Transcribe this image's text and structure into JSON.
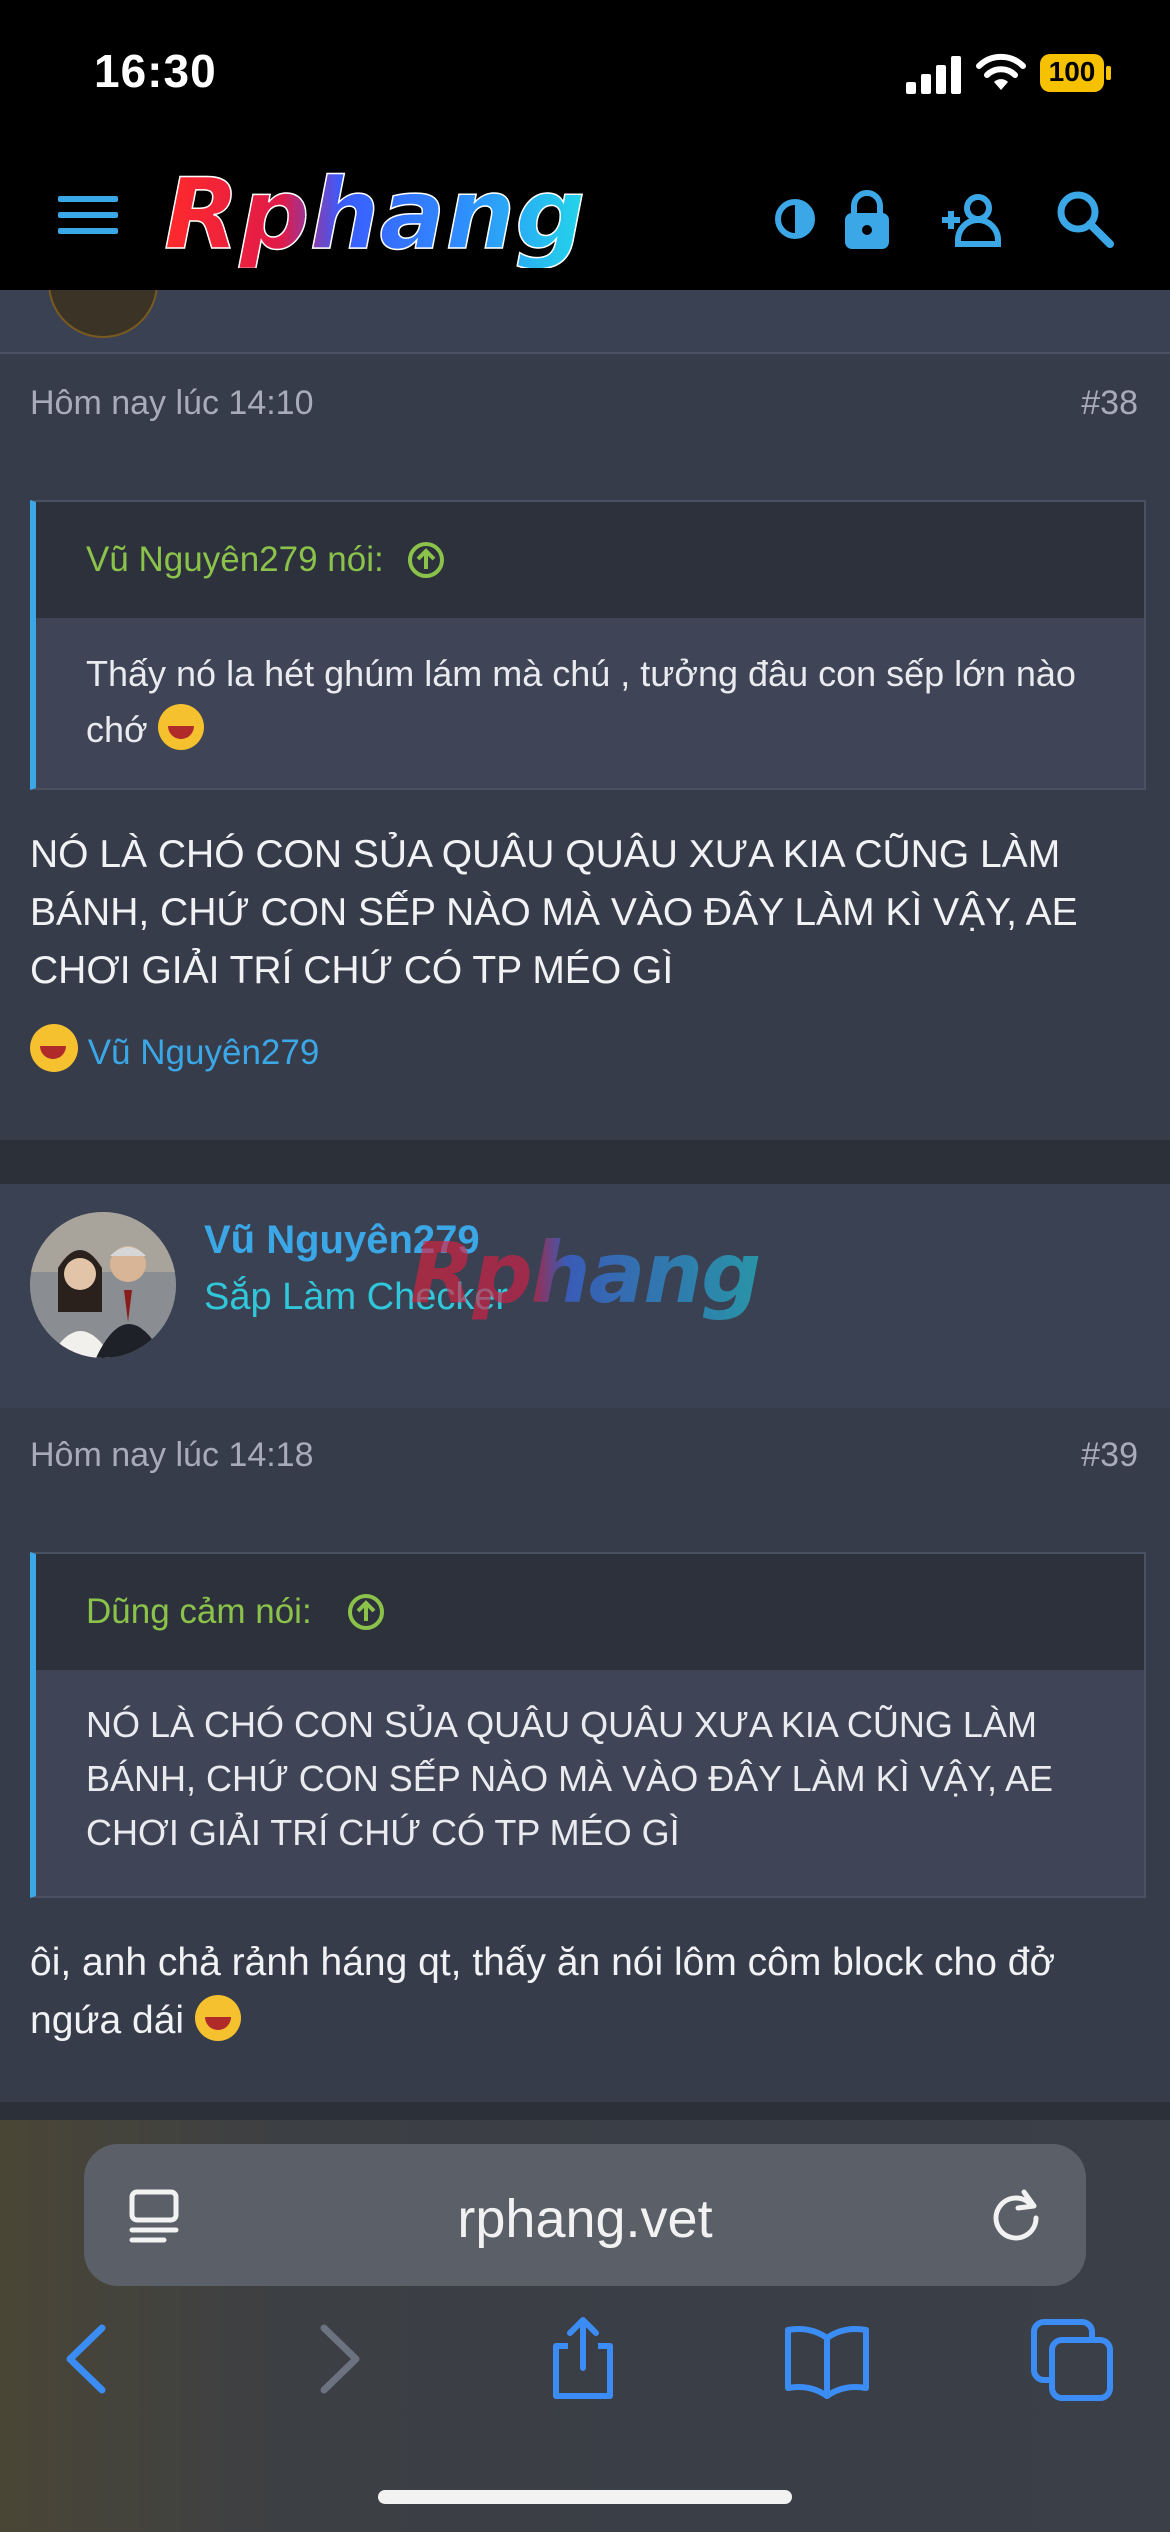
{
  "status_bar": {
    "time": "16:30",
    "battery": "100"
  },
  "header": {
    "logo_text": "Rphang"
  },
  "colors": {
    "accent": "#3ba7e6",
    "quote_author": "#8bc34a",
    "user_title": "#2fc7d9",
    "background": "#2b3039",
    "post_bg": "#363c4a"
  },
  "posts": [
    {
      "timestamp": "Hôm nay lúc 14:10",
      "number": "#38",
      "quote": {
        "author": "Vũ Nguyên279 nói:",
        "text": "Thấy nó la hét ghúm lám mà chú , tưởng đâu con sếp lớn nào chớ"
      },
      "message": "NÓ LÀ CHÓ CON SỦA QUÂU QUÂU XƯA KIA CŨNG LÀM BÁNH, CHỨ CON SẾP NÀO MÀ VÀO ĐÂY LÀM KÌ VẬY, AE CHƠI GIẢI TRÍ CHỨ CÓ TP MÉO GÌ",
      "reaction_user": "Vũ Nguyên279"
    },
    {
      "user": {
        "name": "Vũ Nguyên279",
        "title": "Sắp Làm Checker"
      },
      "watermark": "Rphang",
      "timestamp": "Hôm nay lúc 14:18",
      "number": "#39",
      "quote": {
        "author": "Dũng cảm nói:",
        "text": "NÓ LÀ CHÓ CON SỦA QUÂU QUÂU XƯA KIA CŨNG LÀM BÁNH, CHỨ CON SẾP NÀO MÀ VÀO ĐÂY LÀM KÌ VẬY, AE CHƠI GIẢI TRÍ CHỨ CÓ TP MÉO GÌ"
      },
      "message": "ôi, anh chả rảnh háng qt, thấy ăn nói lôm côm block cho đở ngứa dái"
    }
  ],
  "browser": {
    "url": "rphang.vet"
  },
  "icons": [
    "hamburger-icon",
    "theme-toggle-icon",
    "lock-icon",
    "add-user-icon",
    "search-icon",
    "reader-icon",
    "reload-icon",
    "back-icon",
    "forward-icon",
    "share-icon",
    "bookmarks-icon",
    "tabs-icon",
    "go-to-quote-icon",
    "laugh-emoji-icon"
  ]
}
